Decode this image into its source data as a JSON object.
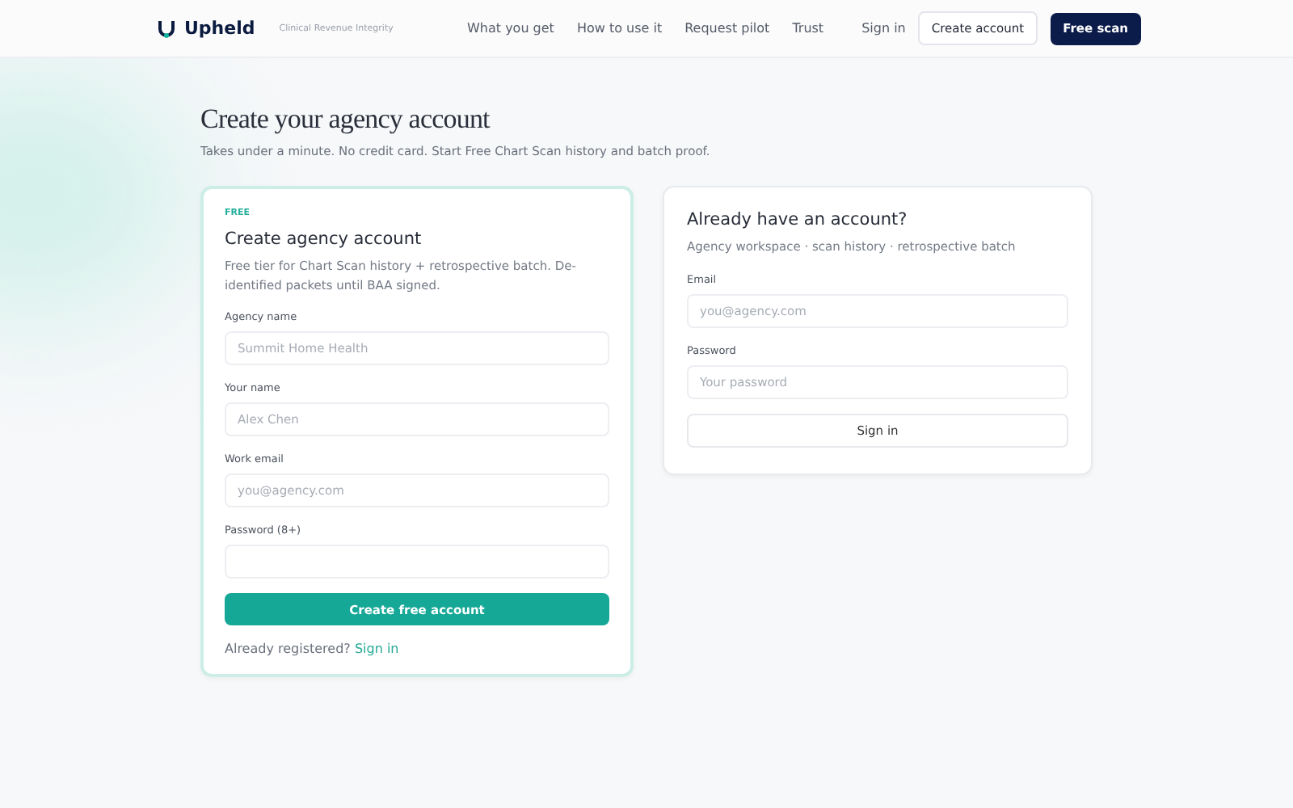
{
  "nav": {
    "brand": "Upheld",
    "tagline": "Clinical Revenue Integrity",
    "links": [
      "What you get",
      "How to use it",
      "Request pilot",
      "Trust"
    ],
    "sign_in": "Sign in",
    "create_account": "Create account",
    "free_scan": "Free scan"
  },
  "page": {
    "title": "Create your agency account",
    "subtitle": "Takes under a minute. No credit card. Start Free Chart Scan history and batch proof."
  },
  "signup": {
    "eyebrow": "FREE",
    "title": "Create agency account",
    "description": "Free tier for Chart Scan history + retrospective batch. De-identified packets until BAA signed.",
    "fields": [
      {
        "label": "Agency name",
        "placeholder": "Summit Home Health"
      },
      {
        "label": "Your name",
        "placeholder": "Alex Chen"
      },
      {
        "label": "Work email",
        "placeholder": "you@agency.com"
      },
      {
        "label": "Password (8+)"
      }
    ],
    "submit": "Create free account",
    "footer_text": "Already registered?",
    "footer_link": "Sign in"
  },
  "signin": {
    "title": "Already have an account?",
    "description": "Agency workspace · scan history · retrospective batch",
    "fields": [
      {
        "label": "Email",
        "placeholder": "you@agency.com"
      },
      {
        "label": "Password",
        "placeholder": "Your password"
      }
    ],
    "submit": "Sign in"
  }
}
